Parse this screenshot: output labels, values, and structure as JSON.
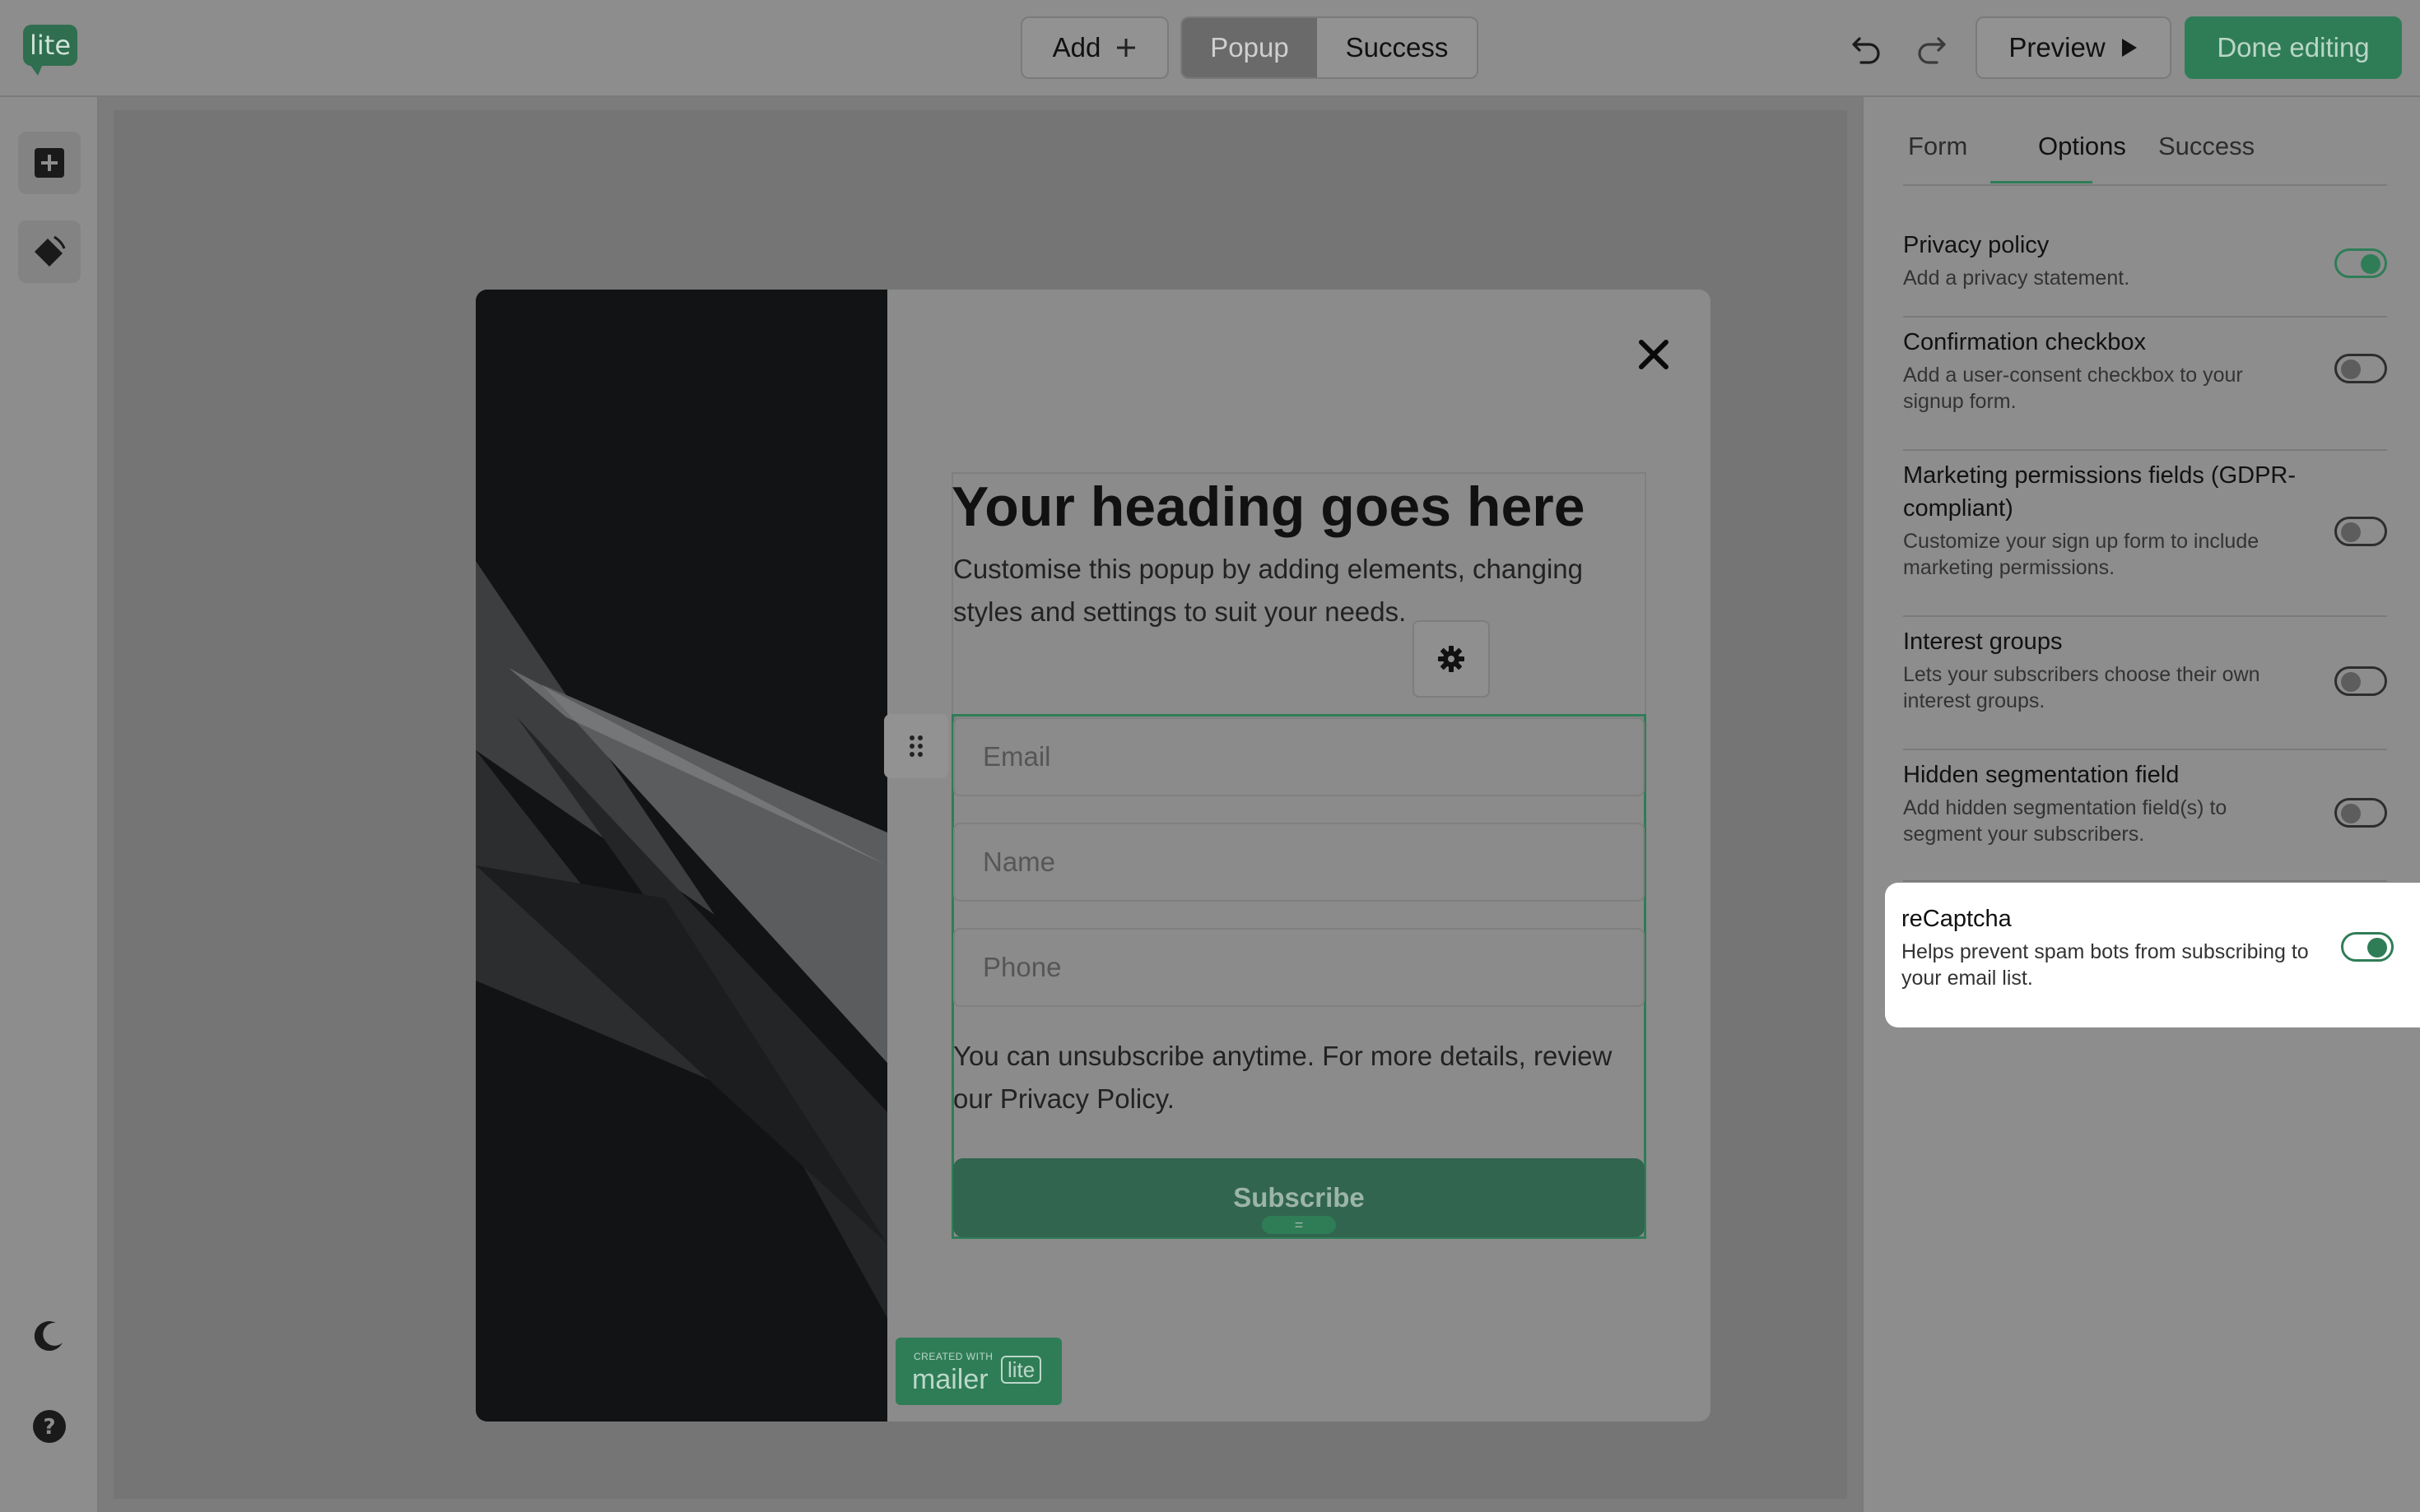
{
  "topbar": {
    "logo_text": "lite",
    "add_label": "Add",
    "segments": [
      {
        "label": "Popup",
        "active": true
      },
      {
        "label": "Success",
        "active": false
      }
    ],
    "preview_label": "Preview",
    "done_label": "Done editing"
  },
  "leftbar": {
    "items": [
      "plus-icon",
      "paint-bucket-icon"
    ],
    "bottom_items": [
      "moon-icon",
      "help-icon"
    ]
  },
  "popup": {
    "heading": "Your heading goes here",
    "subtext": "Customise this popup by adding elements, changing styles and settings to suit your needs.",
    "fields": [
      {
        "placeholder": "Email"
      },
      {
        "placeholder": "Name"
      },
      {
        "placeholder": "Phone"
      }
    ],
    "disclaimer": "You can unsubscribe anytime. For more details, review our Privacy Policy.",
    "subscribe_label": "Subscribe",
    "badge": {
      "small": "CREATED WITH",
      "word": "mailer",
      "lite": "lite"
    }
  },
  "rightpanel": {
    "tabs": [
      {
        "label": "Form",
        "active": false
      },
      {
        "label": "Options",
        "active": true
      },
      {
        "label": "Success",
        "active": false
      }
    ],
    "options": [
      {
        "title": "Privacy policy",
        "description": "Add a privacy statement.",
        "enabled": true
      },
      {
        "title": "Confirmation checkbox",
        "description": "Add a user-consent checkbox to your signup form.",
        "enabled": false
      },
      {
        "title": "Marketing permissions fields (GDPR-compliant)",
        "description": "Customize your sign up form to include marketing permissions.",
        "enabled": false
      },
      {
        "title": "Interest groups",
        "description": "Lets your subscribers choose their own interest groups.",
        "enabled": false
      },
      {
        "title": "Hidden segmentation field",
        "description": "Add hidden segmentation field(s) to segment your subscribers.",
        "enabled": false
      },
      {
        "title": "reCaptcha",
        "description": "Helps prevent spam bots from subscribing to your email list.",
        "enabled": true
      }
    ]
  },
  "colors": {
    "accent": "#2f7d57",
    "overlay": "#7c7c7c",
    "highlight": "#ffffff"
  }
}
